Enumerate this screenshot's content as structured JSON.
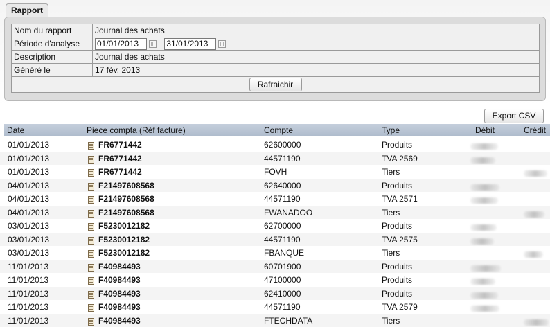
{
  "tab": {
    "label": "Rapport"
  },
  "report": {
    "name_label": "Nom du rapport",
    "name_value": "Journal des achats",
    "period_label": "Période d'analyse",
    "period_from": "01/01/2013",
    "period_separator": "-",
    "period_to": "31/01/2013",
    "description_label": "Description",
    "description_value": "Journal des achats",
    "generated_label": "Généré le",
    "generated_value": "17 fév. 2013",
    "refresh_label": "Rafraichir"
  },
  "export_label": "Export CSV",
  "columns": {
    "date": "Date",
    "piece": "Piece compta (Réf facture)",
    "compte": "Compte",
    "type": "Type",
    "debit": "Débit",
    "credit": "Crédit"
  },
  "rows": [
    {
      "date": "01/01/2013",
      "piece": "FR6771442",
      "compte": "62600000",
      "type": "Produits",
      "side": "debit"
    },
    {
      "date": "01/01/2013",
      "piece": "FR6771442",
      "compte": "44571190",
      "type": "TVA 2569",
      "side": "debit"
    },
    {
      "date": "01/01/2013",
      "piece": "FR6771442",
      "compte": "FOVH",
      "type": "Tiers",
      "side": "credit"
    },
    {
      "date": "04/01/2013",
      "piece": "F21497608568",
      "compte": "62640000",
      "type": "Produits",
      "side": "debit"
    },
    {
      "date": "04/01/2013",
      "piece": "F21497608568",
      "compte": "44571190",
      "type": "TVA 2571",
      "side": "debit"
    },
    {
      "date": "04/01/2013",
      "piece": "F21497608568",
      "compte": "FWANADOO",
      "type": "Tiers",
      "side": "credit"
    },
    {
      "date": "03/01/2013",
      "piece": "F5230012182",
      "compte": "62700000",
      "type": "Produits",
      "side": "debit"
    },
    {
      "date": "03/01/2013",
      "piece": "F5230012182",
      "compte": "44571190",
      "type": "TVA 2575",
      "side": "debit"
    },
    {
      "date": "03/01/2013",
      "piece": "F5230012182",
      "compte": "FBANQUE",
      "type": "Tiers",
      "side": "credit"
    },
    {
      "date": "11/01/2013",
      "piece": "F40984493",
      "compte": "60701900",
      "type": "Produits",
      "side": "debit"
    },
    {
      "date": "11/01/2013",
      "piece": "F40984493",
      "compte": "47100000",
      "type": "Produits",
      "side": "debit"
    },
    {
      "date": "11/01/2013",
      "piece": "F40984493",
      "compte": "62410000",
      "type": "Produits",
      "side": "debit"
    },
    {
      "date": "11/01/2013",
      "piece": "F40984493",
      "compte": "44571190",
      "type": "TVA 2579",
      "side": "debit"
    },
    {
      "date": "11/01/2013",
      "piece": "F40984493",
      "compte": "FTECHDATA",
      "type": "Tiers",
      "side": "credit"
    }
  ]
}
